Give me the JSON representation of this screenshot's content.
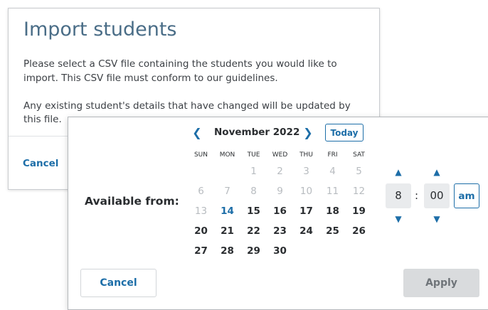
{
  "import_dialog": {
    "title": "Import students",
    "paragraph1": "Please select a CSV file containing the students you would like to import. This CSV file must conform to our guidelines.",
    "paragraph2": "Any existing student's details that have changed will be updated by this file.",
    "cancel_label": "Cancel"
  },
  "date_picker": {
    "label": "Available from:",
    "month": "November 2022",
    "today_label": "Today",
    "prev_icon": "chevron-left-icon",
    "next_icon": "chevron-right-icon",
    "weekdays": [
      "SUN",
      "MON",
      "TUE",
      "WED",
      "THU",
      "FRI",
      "SAT"
    ],
    "weeks": [
      [
        "",
        "",
        "1",
        "2",
        "3",
        "4",
        "5"
      ],
      [
        "6",
        "7",
        "8",
        "9",
        "10",
        "11",
        "12"
      ],
      [
        "13",
        "14",
        "15",
        "16",
        "17",
        "18",
        "19"
      ],
      [
        "20",
        "21",
        "22",
        "23",
        "24",
        "25",
        "26"
      ],
      [
        "27",
        "28",
        "29",
        "30",
        "",
        "",
        ""
      ]
    ],
    "today_day": "14",
    "time": {
      "hour": "8",
      "separator": ":",
      "minute": "00",
      "period": "am"
    },
    "cancel_label": "Cancel",
    "apply_label": "Apply"
  },
  "colors": {
    "accent": "#1d6ea8",
    "title": "#4a6d87",
    "disabled_text": "#b8bcc0",
    "apply_bg": "#d9dbdd"
  }
}
